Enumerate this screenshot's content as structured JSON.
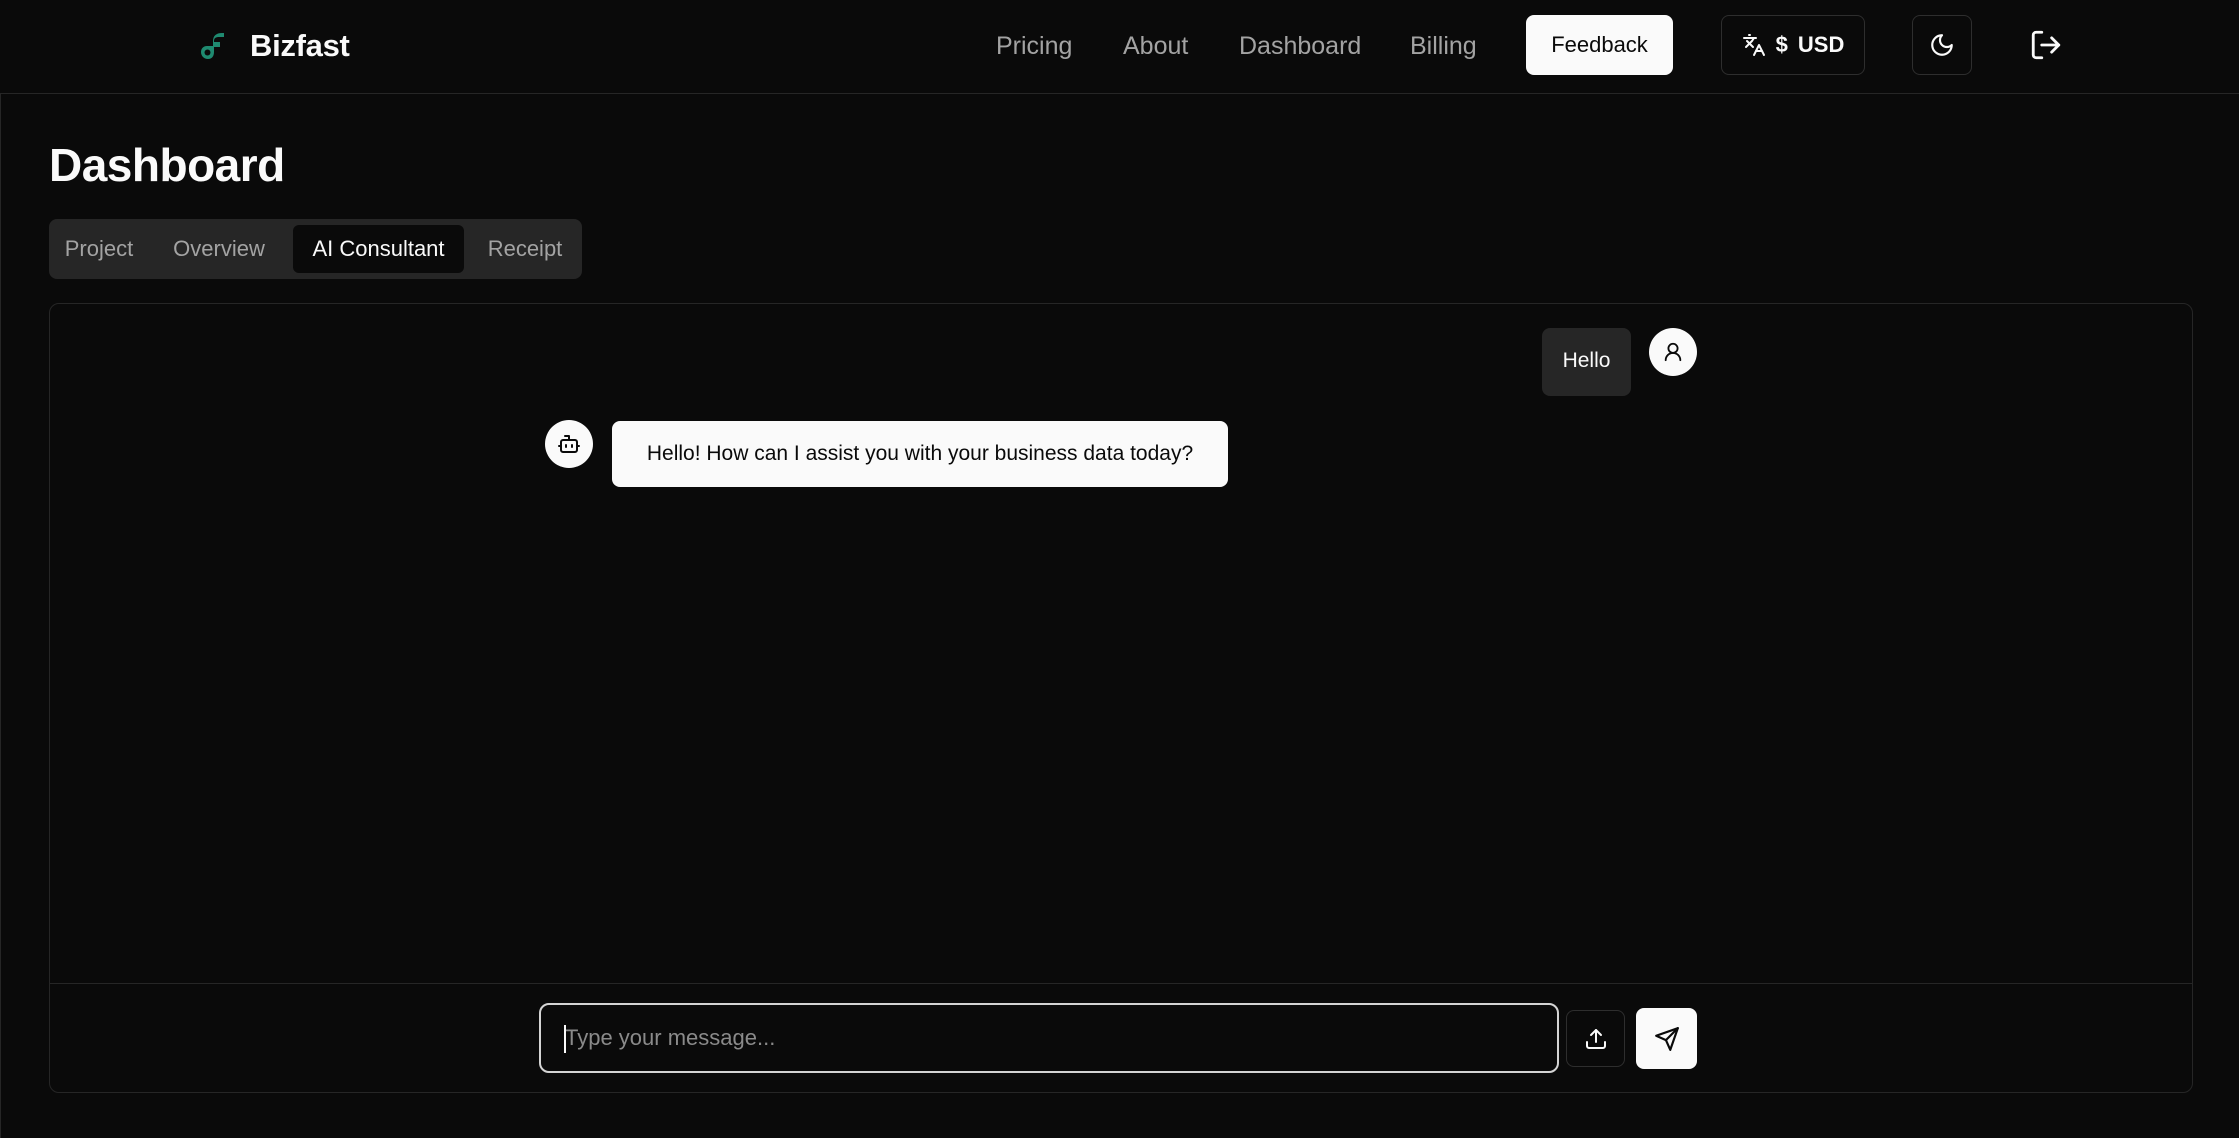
{
  "app": {
    "name": "Bizfast",
    "brand_color": "#1f8a70"
  },
  "nav": {
    "links": [
      "Pricing",
      "About",
      "Dashboard",
      "Billing"
    ],
    "feedback_label": "Feedback",
    "currency": {
      "symbol": "$",
      "code": "USD",
      "icon": "translate-icon"
    },
    "theme_icon": "moon-icon",
    "logout_icon": "logout-icon"
  },
  "page": {
    "title": "Dashboard",
    "tabs": [
      {
        "label": "Project",
        "active": false
      },
      {
        "label": "Overview",
        "active": false
      },
      {
        "label": "AI Consultant",
        "active": true
      },
      {
        "label": "Receipt",
        "active": false
      }
    ]
  },
  "chat": {
    "messages": [
      {
        "role": "user",
        "text": "Hello",
        "avatar_icon": "user-icon"
      },
      {
        "role": "assistant",
        "text": "Hello! How can I assist you with your business data today?",
        "avatar_icon": "bot-icon"
      }
    ],
    "composer": {
      "value": "",
      "placeholder": "Type your message...",
      "upload_icon": "upload-icon",
      "send_icon": "send-icon"
    }
  },
  "colors": {
    "background": "#0a0a0a",
    "border": "#262626",
    "muted_text": "#a3a3a3",
    "foreground": "#fafafa"
  }
}
